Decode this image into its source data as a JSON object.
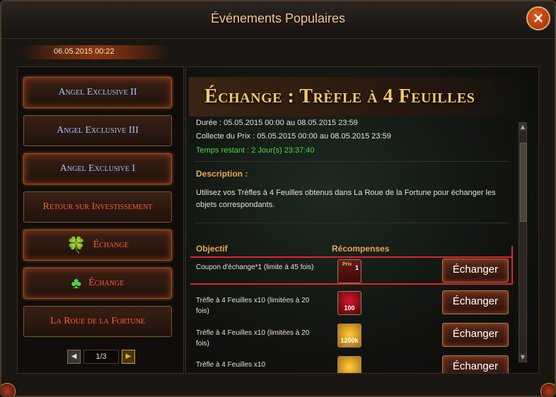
{
  "window": {
    "title": "Événements Populaires",
    "close_icon": "close-icon"
  },
  "date": "06.05.2015 00:22",
  "sidebar": {
    "items": [
      {
        "label": "Angel Exclusive II",
        "style": "blue"
      },
      {
        "label": "Angel Exclusive III",
        "style": "blue"
      },
      {
        "label": "Angel Exclusive I",
        "style": "blue"
      },
      {
        "label": "Retour sur Investissement",
        "style": "red"
      },
      {
        "label": "Échange",
        "style": "red",
        "icon": "clover-basket-icon"
      },
      {
        "label": "Échange",
        "style": "red",
        "icon": "clover-icon"
      },
      {
        "label": "La Roue de la Fortune",
        "style": "red"
      }
    ],
    "pager": {
      "current": "1/3",
      "prev_icon": "arrow-left-icon",
      "next_icon": "arrow-right-icon"
    }
  },
  "event": {
    "title": "Échange : Trèfle à 4 Feuilles",
    "duration": "Durée : 05.05.2015 00:00 au 08.05.2015 23:59",
    "collection": "Collecte du Prix : 05.05.2015 00:00 au 08.05.2015 23:59",
    "remaining": "Temps restant : 2 Jour(s)  23:37:40",
    "description_header": "Description :",
    "description": "Utilisez vos Trèfles à 4 Feuilles obtenus dans La Roue de la Fortune pour échanger les objets correspondants.",
    "objective_header": "Objectif",
    "rewards_header": "Récompenses",
    "rows": [
      {
        "objective": "Coupon d'échange*1 (limite à 45 fois)",
        "reward_label": "Prix",
        "reward_count": "1",
        "reward_type": "coupon",
        "button": "Échanger"
      },
      {
        "objective": "Trèfle à 4 Feuilles x10 (limitées à 20 fois)",
        "reward_count": "100",
        "reward_type": "clover",
        "button": "Échanger"
      },
      {
        "objective": "Trèfle à 4 Feuilles x10 (limitées à 20 fois)",
        "reward_count": "1200k",
        "reward_type": "gold",
        "button": "Échanger"
      },
      {
        "objective": "Trèfle à 4 Feuilles x10",
        "reward_count": "",
        "reward_type": "gold",
        "button": "Échanger"
      }
    ]
  }
}
